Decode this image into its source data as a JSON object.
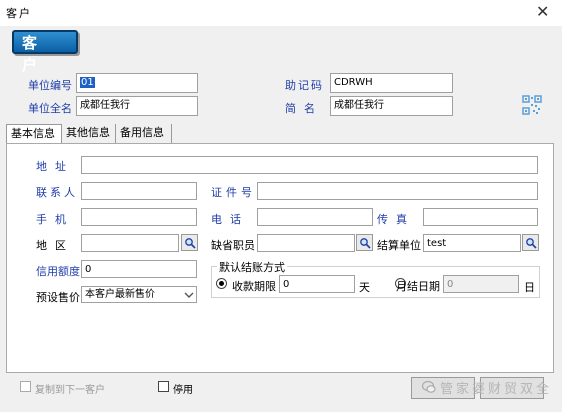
{
  "window": {
    "title": "客户",
    "close_glyph": "✕"
  },
  "header": {
    "badge": "客 户"
  },
  "top_fields": {
    "code_label": "单位编号",
    "code_value": "01",
    "mnemonic_label": "助记码",
    "mnemonic_value": "CDRWH",
    "fullname_label": "单位全名",
    "fullname_value": "成都任我行",
    "shortname_label": "简名",
    "shortname_value": "成都任我行"
  },
  "tabs": [
    {
      "label": "基本信息",
      "active": true
    },
    {
      "label": "其他信息",
      "active": false
    },
    {
      "label": "备用信息",
      "active": false
    }
  ],
  "basic": {
    "address_label": "地址",
    "address_value": "",
    "contact_label": "联系人",
    "contact_value": "",
    "id_label": "证件号",
    "id_value": "",
    "mobile_label": "手机",
    "mobile_value": "",
    "phone_label": "电话",
    "phone_value": "",
    "fax_label": "传真",
    "fax_value": "",
    "region_label": "地区",
    "region_value": "",
    "staff_label": "缺省职员",
    "staff_value": "",
    "settle_unit_label": "结算单位",
    "settle_unit_value": "test",
    "credit_label": "信用额度",
    "credit_value": "0",
    "price_label": "预设售价",
    "price_value": "本客户最新售价",
    "settle_group_title": "默认结账方式",
    "period_label": "收款期限",
    "period_value": "0",
    "period_unit": "天",
    "monthly_label": "月结日期",
    "monthly_value": "0",
    "monthly_unit": "日"
  },
  "footer": {
    "copy_next_label": "复制到下一客户",
    "disable_label": "停用",
    "watermark": "管家婆财贸双全"
  },
  "colors": {
    "accent": "#1f3ea8",
    "badge": "#0b5fa5",
    "selection": "#1e5fc8"
  },
  "icons": {
    "search": "search-icon",
    "qrcode": "qrcode-icon",
    "dropdown": "chevron-down-icon",
    "close": "close-icon"
  }
}
